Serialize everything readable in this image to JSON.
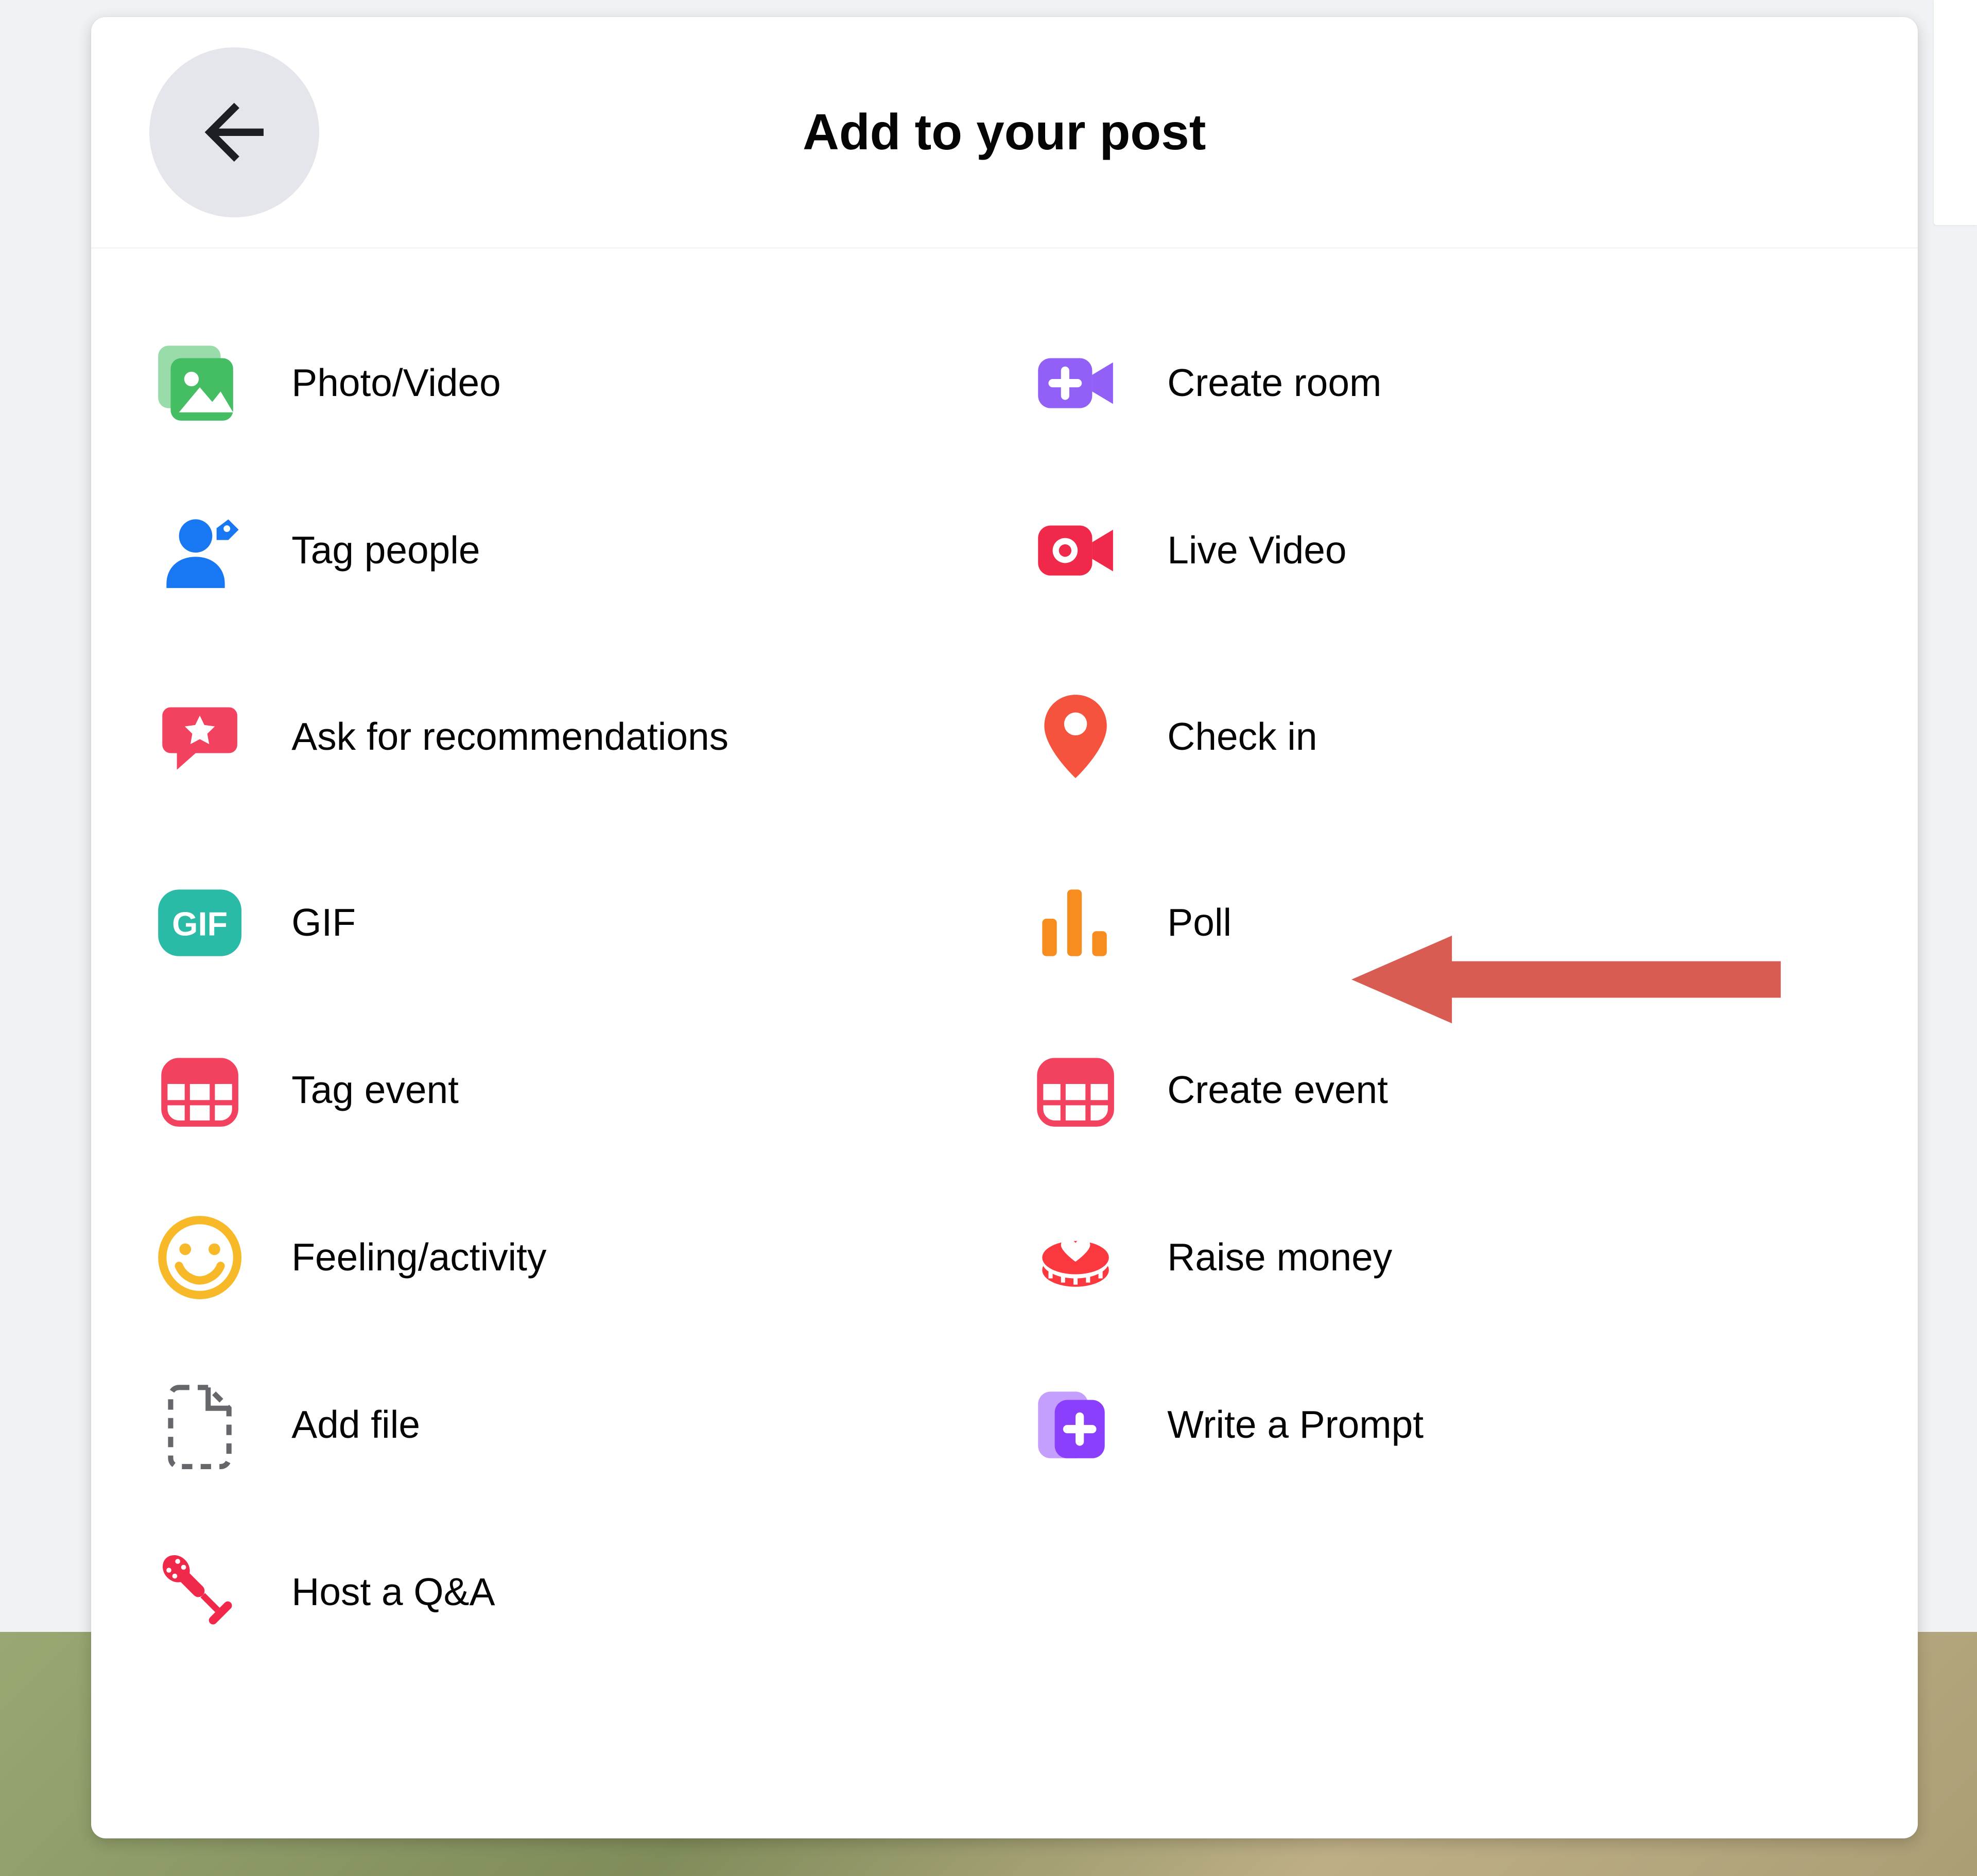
{
  "header": {
    "title": "Add to your post"
  },
  "options": {
    "left": [
      {
        "key": "photo_video",
        "label": "Photo/Video",
        "icon": "photo-video-icon"
      },
      {
        "key": "tag_people",
        "label": "Tag people",
        "icon": "tag-people-icon"
      },
      {
        "key": "ask_recommendations",
        "label": "Ask for recommendations",
        "icon": "recommendations-icon"
      },
      {
        "key": "gif",
        "label": "GIF",
        "icon": "gif-icon"
      },
      {
        "key": "tag_event",
        "label": "Tag event",
        "icon": "tag-event-icon"
      },
      {
        "key": "feeling_activity",
        "label": "Feeling/activity",
        "icon": "feeling-icon"
      },
      {
        "key": "add_file",
        "label": "Add file",
        "icon": "add-file-icon"
      },
      {
        "key": "host_qa",
        "label": "Host a Q&A",
        "icon": "host-qa-icon"
      }
    ],
    "right": [
      {
        "key": "create_room",
        "label": "Create room",
        "icon": "create-room-icon"
      },
      {
        "key": "live_video",
        "label": "Live Video",
        "icon": "live-video-icon"
      },
      {
        "key": "check_in",
        "label": "Check in",
        "icon": "check-in-icon"
      },
      {
        "key": "poll",
        "label": "Poll",
        "icon": "poll-icon"
      },
      {
        "key": "create_event",
        "label": "Create event",
        "icon": "create-event-icon"
      },
      {
        "key": "raise_money",
        "label": "Raise money",
        "icon": "raise-money-icon"
      },
      {
        "key": "write_prompt",
        "label": "Write a Prompt",
        "icon": "write-prompt-icon"
      }
    ]
  },
  "annotation": {
    "target": "poll",
    "color": "#d95c52"
  },
  "colors": {
    "green": "#45bd62",
    "blue": "#1877f2",
    "red": "#f3425f",
    "teal": "#2abba7",
    "pinkred": "#f3425f",
    "yellow": "#f7b928",
    "grey": "#65676b",
    "red2": "#f02849",
    "purple": "#9360f7",
    "orange": "#f5533d",
    "orangeBars": "#f78c1f",
    "donateRed": "#fa383e",
    "promptPurple": "#8a3ffc"
  }
}
